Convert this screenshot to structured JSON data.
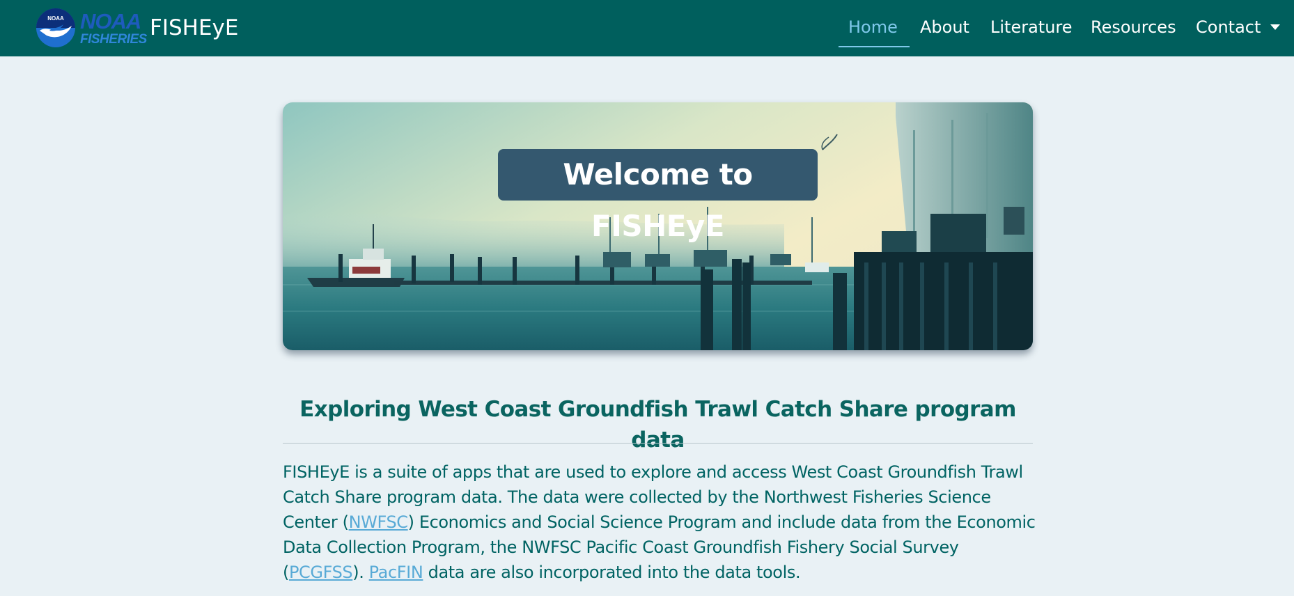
{
  "header": {
    "logo": {
      "line1": "NOAA",
      "line2": "FISHERIES",
      "emblem_text": "NOAA"
    },
    "site_name": "FISHEyE",
    "nav": {
      "home": "Home",
      "about": "About",
      "literature": "Literature",
      "resources": "Resources",
      "contact": "Contact"
    },
    "active_item": "Home"
  },
  "hero": {
    "title": "Welcome to FISHEyE",
    "image_icon": "harbor-photo"
  },
  "main": {
    "heading": "Exploring West Coast Groundfish Trawl Catch Share program data",
    "intro": {
      "part1": "FISHEyE is a suite of apps that are used to explore and access West Coast Groundfish Trawl Catch Share program data. The data were collected by the Northwest Fisheries Science Center (",
      "link_nwfsc": "NWFSC",
      "part2": ") Economics and Social Science Program and include data from the Economic Data Collection Program, the NWFSC Pacific Coast Groundfish Fishery Social Survey (",
      "link_pcgfss": "PCGFSS",
      "part3": "). ",
      "link_pacfin": "PacFIN",
      "part4": " data are also incorporated into the data tools."
    }
  },
  "colors": {
    "navbar": "#005f5d",
    "page_background": "#e9f1f5",
    "active_nav": "#7fc8ea",
    "title_box": "#34586f",
    "link": "#58aad6",
    "text": "#006363"
  }
}
